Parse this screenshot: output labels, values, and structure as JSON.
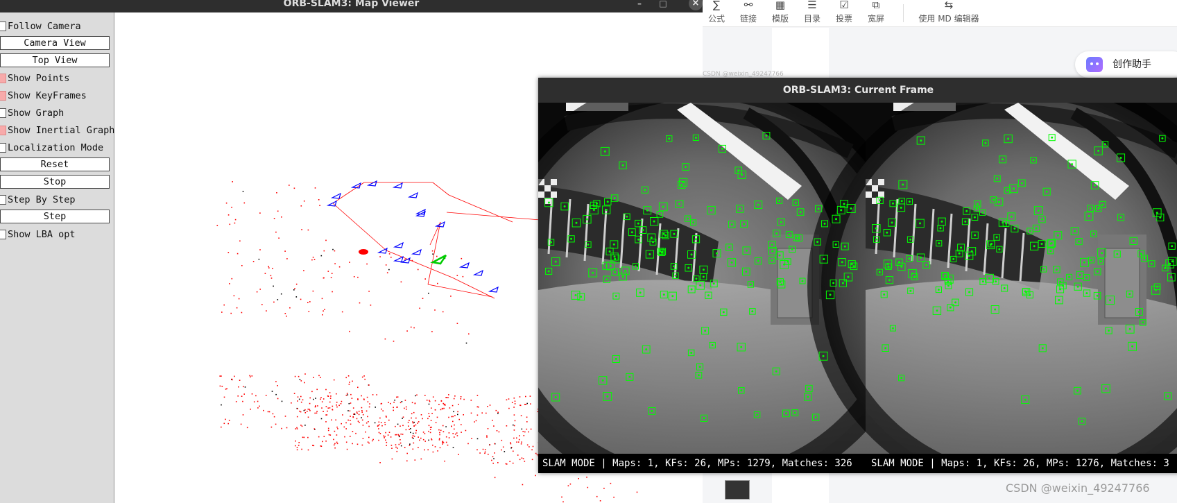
{
  "map_viewer": {
    "title": "ORB-SLAM3: Map Viewer",
    "controls": [
      {
        "type": "checkbox",
        "label": "Follow Camera",
        "checked": false
      },
      {
        "type": "button",
        "label": "Camera View"
      },
      {
        "type": "button",
        "label": "Top View"
      },
      {
        "type": "checkbox",
        "label": "Show Points",
        "checked": true
      },
      {
        "type": "checkbox",
        "label": "Show KeyFrames",
        "checked": true
      },
      {
        "type": "checkbox",
        "label": "Show Graph",
        "checked": false
      },
      {
        "type": "checkbox",
        "label": "Show Inertial Graph",
        "checked": true
      },
      {
        "type": "checkbox",
        "label": "Localization Mode",
        "checked": false
      },
      {
        "type": "button",
        "label": "Reset"
      },
      {
        "type": "button",
        "label": "Stop"
      },
      {
        "type": "checkbox",
        "label": "Step By Step",
        "checked": false
      },
      {
        "type": "button",
        "label": "Step"
      },
      {
        "type": "checkbox",
        "label": "Show LBA opt",
        "checked": false
      }
    ],
    "colors": {
      "map_points": "#ff0000",
      "keyframes": "#0000ff",
      "current_camera": "#00cc00",
      "graph": "#ff0000"
    }
  },
  "current_frame": {
    "title": "ORB-SLAM3: Current Frame",
    "left_status": "SLAM MODE |  Maps: 1, KFs: 26, MPs: 1279, Matches: 326",
    "right_status": "SLAM MODE |  Maps: 1, KFs: 26, MPs: 1276, Matches: 3",
    "feature_color": "#00ff00"
  },
  "editor": {
    "toolbar": [
      {
        "icon": "sigma-icon",
        "glyph": "∑",
        "label": "公式"
      },
      {
        "icon": "link-icon",
        "glyph": "⚯",
        "label": "链接"
      },
      {
        "icon": "template-icon",
        "glyph": "▦",
        "label": "模版"
      },
      {
        "icon": "list-icon",
        "glyph": "☰",
        "label": "目录"
      },
      {
        "icon": "vote-icon",
        "glyph": "☑",
        "label": "投票"
      },
      {
        "icon": "widescreen-icon",
        "glyph": "⧉",
        "label": "宽屏"
      }
    ],
    "md_editor_label": "使用 MD 编辑器",
    "md_editor_glyph": "⇆",
    "assistant_label": "创作助手",
    "watermark": "CSDN @weixin_49247766",
    "faint_text": "CSDN @weixin_49247766"
  }
}
